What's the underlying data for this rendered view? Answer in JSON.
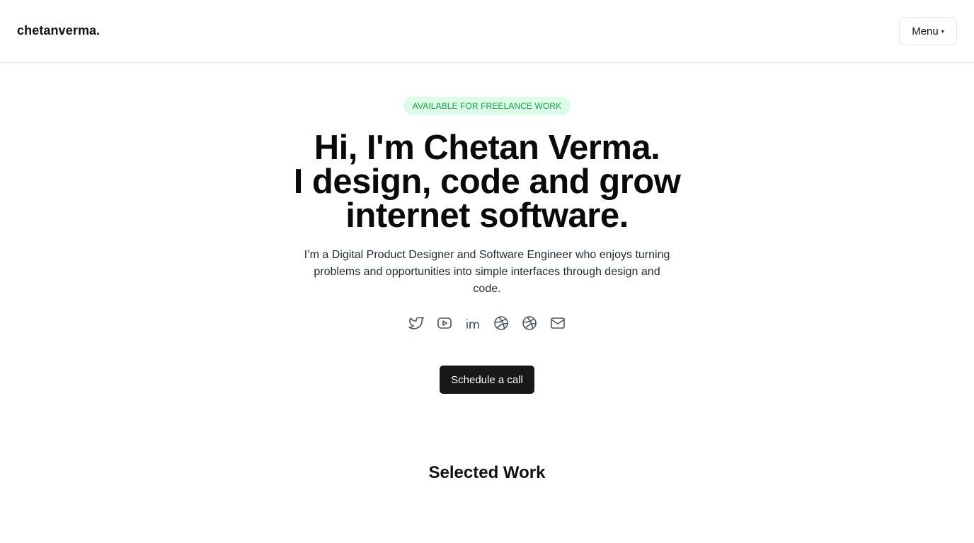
{
  "header": {
    "logo": "chetanverma.",
    "menu_label": "Menu",
    "menu_caret": "▾"
  },
  "hero": {
    "badge": "AVAILABLE FOR FREELANCE WORK",
    "headline_lines": [
      "Hi, I'm Chetan Verma.",
      "I design, code and grow",
      "internet software."
    ],
    "intro": "I’m a Digital Product Designer and Software Engineer who enjoys turning problems and opportunities into simple interfaces through design and code.",
    "socials": [
      {
        "icon": "twitter-icon"
      },
      {
        "icon": "youtube-icon"
      },
      {
        "icon": "linkedin-icon"
      },
      {
        "icon": "dribbble-icon"
      },
      {
        "icon": "dribbble-icon"
      },
      {
        "icon": "mail-icon"
      }
    ],
    "cta_label": "Schedule a call"
  },
  "sections": {
    "selected_work_title": "Selected Work"
  },
  "colors": {
    "badge_bg": "#dcfce7",
    "badge_text": "#16a34a",
    "cta_bg": "#18181b",
    "icon_stroke": "#4b5563"
  }
}
